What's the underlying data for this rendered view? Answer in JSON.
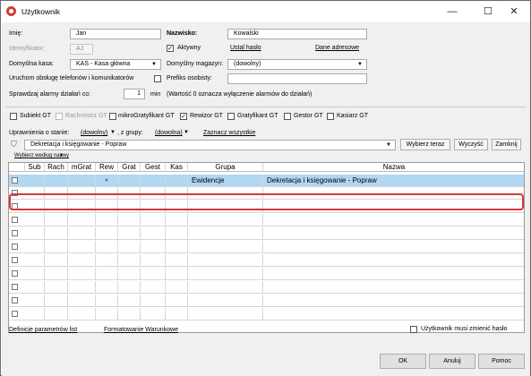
{
  "window": {
    "title": "Użytkownik",
    "minimize": "—",
    "maximize": "☐",
    "close": "✕"
  },
  "form": {
    "imie_label": "Imię:",
    "imie_value": "Jan",
    "nazwisko_label": "Nazwisko:",
    "nazwisko_value": "Kowalski",
    "identyfikator_label": "Identyfikator:",
    "identyfikator_value": "AJ",
    "aktywny_label": "Aktywny",
    "aktywny_checked": "✓",
    "ustal_haslo": "Ustal hasło",
    "dane_adresowe": "Dane adresowe",
    "kasa_label": "Domyślna kasa:",
    "kasa_value": "KAS - Kasa główna",
    "magazyn_label": "Domyślny magazyn:",
    "magazyn_value": "(dowolny)",
    "komunikatory_label": "Uruchom obsługę telefonów i komunikatorów",
    "prefiks_label": "Prefiks osobisty:",
    "prefiks_value": "",
    "alarmy_label": "Sprawdzaj alarmy działań co:",
    "alarmy_value": "1",
    "alarmy_unit": "min",
    "alarmy_note": "(Wartość 0 oznacza wyłączenie alarmów do działań)"
  },
  "roles": [
    {
      "label": "Subiekt GT",
      "checked": "",
      "enabled": true
    },
    {
      "label": "Rachmistrz GT",
      "checked": "",
      "enabled": false
    },
    {
      "label": "mikroGratyfikant GT",
      "checked": "",
      "enabled": true
    },
    {
      "label": "Rewizor GT",
      "checked": "✓",
      "enabled": true
    },
    {
      "label": "Gratyfikant GT",
      "checked": "",
      "enabled": true
    },
    {
      "label": "Gestor GT",
      "checked": "",
      "enabled": true
    },
    {
      "label": "Kasiarz GT",
      "checked": "",
      "enabled": true
    }
  ],
  "filters": {
    "uprawnienia_label": "Uprawnienia o stanie:",
    "stan_value": "(dowolny)",
    "grupy_label": ", z grupy:",
    "grupa_value": "(dowolna)",
    "zaznacz_wszystkie": "Zaznacz wszystkie"
  },
  "search": {
    "value": "Dekretacja i księgowanie - Popraw",
    "wybierz_teraz": "Wybierz teraz",
    "wyczysc": "Wyczyść",
    "zamknij": "Zamknij",
    "wybierz_wedlug": "Wybierz według nazwy"
  },
  "grid": {
    "columns": [
      "Sub",
      "Rach",
      "mGrat",
      "Rew",
      "Grat",
      "Gest",
      "Kas",
      "Grupa",
      "Nazwa"
    ],
    "rows": [
      {
        "grupa": "Ewidencje",
        "nazwa": "Dekretacja i księgowanie - Popraw",
        "rew": "●",
        "selected": true
      }
    ],
    "empty_rows": 10
  },
  "footer": {
    "definicje": "Definicje parametrów list",
    "formatowanie": "Formatowanie Warunkowe",
    "musi_zmienic": "Użytkownik musi zmienić hasło",
    "ok": "OK",
    "anuluj": "Anuluj",
    "pomoc": "Pomoc"
  },
  "colors": {
    "selection": "#b2d7f3",
    "highlight": "#d9343b"
  }
}
